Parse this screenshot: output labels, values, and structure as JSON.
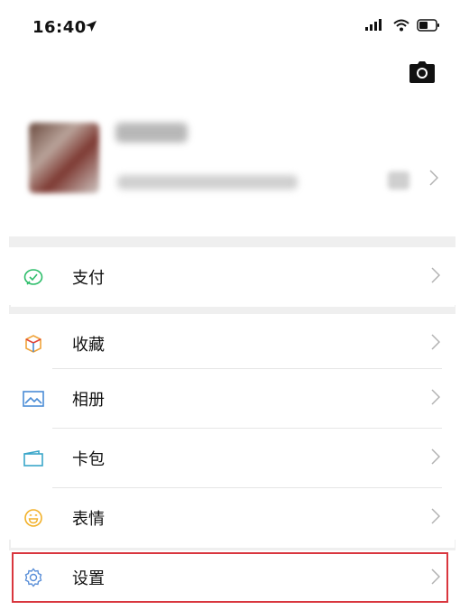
{
  "status_bar": {
    "time": "16:40",
    "location_icon": "location-arrow-icon",
    "signal_icon": "signal-icon",
    "wifi_icon": "wifi-icon",
    "battery_icon": "battery-icon"
  },
  "header": {
    "camera_icon": "camera-icon"
  },
  "profile": {
    "avatar_icon": "avatar-icon",
    "qr_icon": "qr-code-icon"
  },
  "menu": {
    "pay": {
      "label": "支付",
      "icon": "pay-icon",
      "color": "#2dbd6a"
    },
    "favorites": {
      "label": "收藏",
      "icon": "favorites-cube-icon",
      "color": "#f0a43a"
    },
    "album": {
      "label": "相册",
      "icon": "album-icon",
      "color": "#4a8cd6"
    },
    "cards": {
      "label": "卡包",
      "icon": "cards-wallet-icon",
      "color": "#3aa6c9"
    },
    "stickers": {
      "label": "表情",
      "icon": "sticker-smile-icon",
      "color": "#f2b12a"
    },
    "settings": {
      "label": "设置",
      "icon": "gear-icon",
      "color": "#5a8fd8"
    }
  },
  "highlight_color": "#d9363e"
}
